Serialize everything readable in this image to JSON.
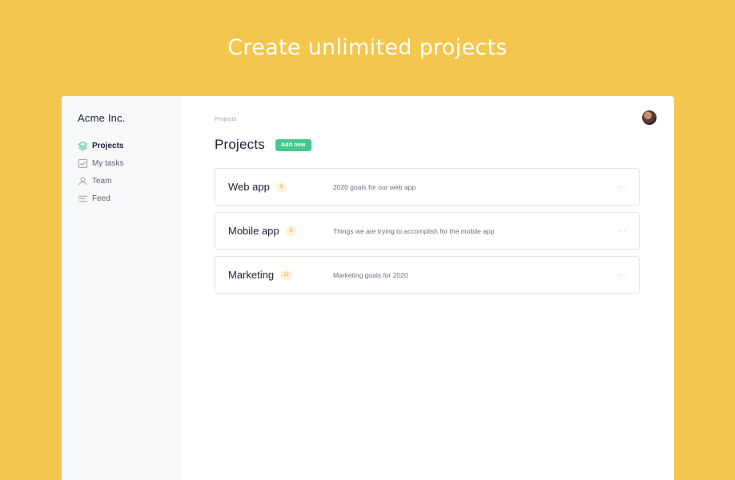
{
  "hero": {
    "title": "Create unlimited projects"
  },
  "sidebar": {
    "company": "Acme Inc.",
    "items": [
      {
        "label": "Projects",
        "icon": "layers-icon",
        "active": true
      },
      {
        "label": "My tasks",
        "icon": "checkbox-icon",
        "active": false
      },
      {
        "label": "Team",
        "icon": "user-icon",
        "active": false
      },
      {
        "label": "Feed",
        "icon": "feed-lines-icon",
        "active": false
      }
    ]
  },
  "main": {
    "breadcrumb": "Projects",
    "title": "Projects",
    "add_new_label": "Add new",
    "projects": [
      {
        "name": "Web app",
        "count": "3",
        "description": "2020 goals for our web app"
      },
      {
        "name": "Mobile app",
        "count": "5",
        "description": "Things we are trying to accomplish for the mobile app"
      },
      {
        "name": "Marketing",
        "count": "12",
        "description": "Marketing goals for 2020"
      }
    ],
    "more_icon": "···"
  },
  "colors": {
    "background": "#F3C64D",
    "accent_green": "#45C98D",
    "text_dark": "#1B1F3B",
    "badge_bg": "#FDF1D6",
    "badge_text": "#D4A142"
  }
}
